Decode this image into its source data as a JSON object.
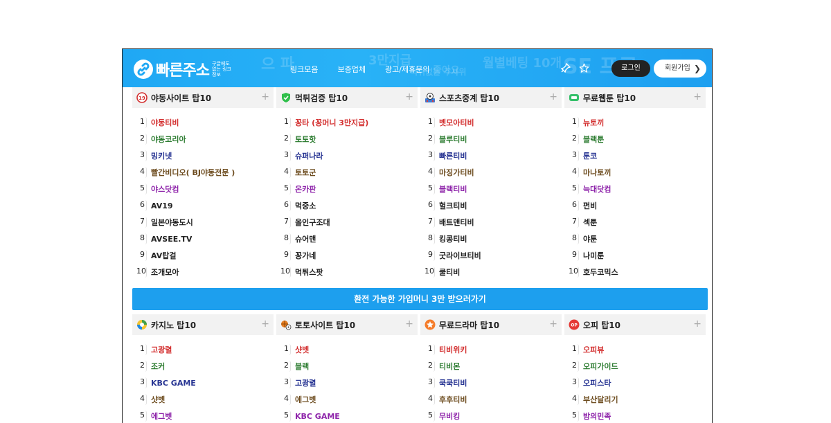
{
  "header": {
    "logo_text": "빠른주소",
    "logo_sub": "구글에도 없는 링크정보",
    "deco": [
      "으 파",
      "3만지급",
      "먹튀없는 주사위",
      "좋아요",
      "월별베팅 10개",
      "SE 프로"
    ],
    "nav": [
      "링크모음",
      "보증업체",
      "광고/제휴문의"
    ],
    "login_label": "로그인",
    "join_label": "회원가입"
  },
  "sections_top": [
    {
      "title": "야동사이트 탑10",
      "icon": "adult-19-icon",
      "items": [
        {
          "n": "1",
          "label": "야동티비",
          "color": "#d32f2f"
        },
        {
          "n": "2",
          "label": "야동코리아",
          "color": "#2e7d32"
        },
        {
          "n": "3",
          "label": "밍키넷",
          "color": "#283593"
        },
        {
          "n": "4",
          "label": "빨간비디오( BJ야동전문 )",
          "color": "#6d4c1f"
        },
        {
          "n": "5",
          "label": "야스닷컴",
          "color": "#8e24aa"
        },
        {
          "n": "6",
          "label": "AV19",
          "color": "#222222"
        },
        {
          "n": "7",
          "label": "일본야동도시",
          "color": "#222222"
        },
        {
          "n": "8",
          "label": "AVSEE.TV",
          "color": "#222222"
        },
        {
          "n": "9",
          "label": "AV탑걸",
          "color": "#222222"
        },
        {
          "n": "10",
          "label": "조개모아",
          "color": "#222222"
        }
      ]
    },
    {
      "title": "먹튀검증 탑10",
      "icon": "shield-check-icon",
      "items": [
        {
          "n": "1",
          "label": "꽁타 (꽁머니 3만지급)",
          "color": "#d32f2f"
        },
        {
          "n": "2",
          "label": "토토핫",
          "color": "#2e7d32"
        },
        {
          "n": "3",
          "label": "슈퍼나라",
          "color": "#283593"
        },
        {
          "n": "4",
          "label": "토토군",
          "color": "#6d4c1f"
        },
        {
          "n": "5",
          "label": "온카판",
          "color": "#8e24aa"
        },
        {
          "n": "6",
          "label": "먹중소",
          "color": "#222222"
        },
        {
          "n": "7",
          "label": "올인구조대",
          "color": "#222222"
        },
        {
          "n": "8",
          "label": "슈어맨",
          "color": "#222222"
        },
        {
          "n": "9",
          "label": "꽁가네",
          "color": "#222222"
        },
        {
          "n": "10",
          "label": "먹튀스팟",
          "color": "#222222"
        }
      ]
    },
    {
      "title": "스포츠중계 탑10",
      "icon": "soccer-ball-icon",
      "items": [
        {
          "n": "1",
          "label": "벳모아티비",
          "color": "#d32f2f"
        },
        {
          "n": "2",
          "label": "블루티비",
          "color": "#2e7d32"
        },
        {
          "n": "3",
          "label": "빠른티비",
          "color": "#283593"
        },
        {
          "n": "4",
          "label": "마징가티비",
          "color": "#6d4c1f"
        },
        {
          "n": "5",
          "label": "블랙티비",
          "color": "#8e24aa"
        },
        {
          "n": "6",
          "label": "헐크티비",
          "color": "#222222"
        },
        {
          "n": "7",
          "label": "배트맨티비",
          "color": "#222222"
        },
        {
          "n": "8",
          "label": "킹콩티비",
          "color": "#222222"
        },
        {
          "n": "9",
          "label": "굿라이브티비",
          "color": "#222222"
        },
        {
          "n": "10",
          "label": "쿨티비",
          "color": "#222222"
        }
      ]
    },
    {
      "title": "무료웹툰 탑10",
      "icon": "webtoon-icon",
      "items": [
        {
          "n": "1",
          "label": "뉴토끼",
          "color": "#d32f2f"
        },
        {
          "n": "2",
          "label": "블랙툰",
          "color": "#2e7d32"
        },
        {
          "n": "3",
          "label": "툰코",
          "color": "#283593"
        },
        {
          "n": "4",
          "label": "마나토끼",
          "color": "#6d4c1f"
        },
        {
          "n": "5",
          "label": "늑대닷컴",
          "color": "#8e24aa"
        },
        {
          "n": "6",
          "label": "펀비",
          "color": "#222222"
        },
        {
          "n": "7",
          "label": "섹툰",
          "color": "#222222"
        },
        {
          "n": "8",
          "label": "야툰",
          "color": "#222222"
        },
        {
          "n": "9",
          "label": "나미툰",
          "color": "#222222"
        },
        {
          "n": "10",
          "label": "호두코믹스",
          "color": "#222222"
        }
      ]
    }
  ],
  "banner": {
    "label": "환전 가능한 가입머니 3만 받으러가기"
  },
  "sections_bottom": [
    {
      "title": "카지노 탑10",
      "icon": "casino-chip-icon",
      "items": [
        {
          "n": "1",
          "label": "고광렬",
          "color": "#d32f2f"
        },
        {
          "n": "2",
          "label": "조커",
          "color": "#2e7d32"
        },
        {
          "n": "3",
          "label": "KBC GAME",
          "color": "#283593"
        },
        {
          "n": "4",
          "label": "샷벳",
          "color": "#6d4c1f"
        },
        {
          "n": "5",
          "label": "에그벳",
          "color": "#8e24aa"
        }
      ]
    },
    {
      "title": "토토사이트 탑10",
      "icon": "sports-balls-icon",
      "items": [
        {
          "n": "1",
          "label": "샷벳",
          "color": "#d32f2f"
        },
        {
          "n": "2",
          "label": "블랙",
          "color": "#2e7d32"
        },
        {
          "n": "3",
          "label": "고광렬",
          "color": "#283593"
        },
        {
          "n": "4",
          "label": "에그벳",
          "color": "#6d4c1f"
        },
        {
          "n": "5",
          "label": "KBC GAME",
          "color": "#8e24aa"
        }
      ]
    },
    {
      "title": "무료드라마 탑10",
      "icon": "drama-star-icon",
      "items": [
        {
          "n": "1",
          "label": "티비위키",
          "color": "#d32f2f"
        },
        {
          "n": "2",
          "label": "티비몬",
          "color": "#2e7d32"
        },
        {
          "n": "3",
          "label": "쿡쿡티비",
          "color": "#283593"
        },
        {
          "n": "4",
          "label": "후후티비",
          "color": "#6d4c1f"
        },
        {
          "n": "5",
          "label": "무비킹",
          "color": "#8e24aa"
        }
      ]
    },
    {
      "title": "오피 탑10",
      "icon": "op-badge-icon",
      "items": [
        {
          "n": "1",
          "label": "오피뷰",
          "color": "#d32f2f"
        },
        {
          "n": "2",
          "label": "오피가이드",
          "color": "#2e7d32"
        },
        {
          "n": "3",
          "label": "오피스타",
          "color": "#283593"
        },
        {
          "n": "4",
          "label": "부산달리기",
          "color": "#6d4c1f"
        },
        {
          "n": "5",
          "label": "밤의민족",
          "color": "#8e24aa"
        }
      ]
    }
  ],
  "colors": {
    "header_bg": "#1fa8f4",
    "banner_bg": "#1d9fee",
    "accent_dark": "#222222"
  }
}
